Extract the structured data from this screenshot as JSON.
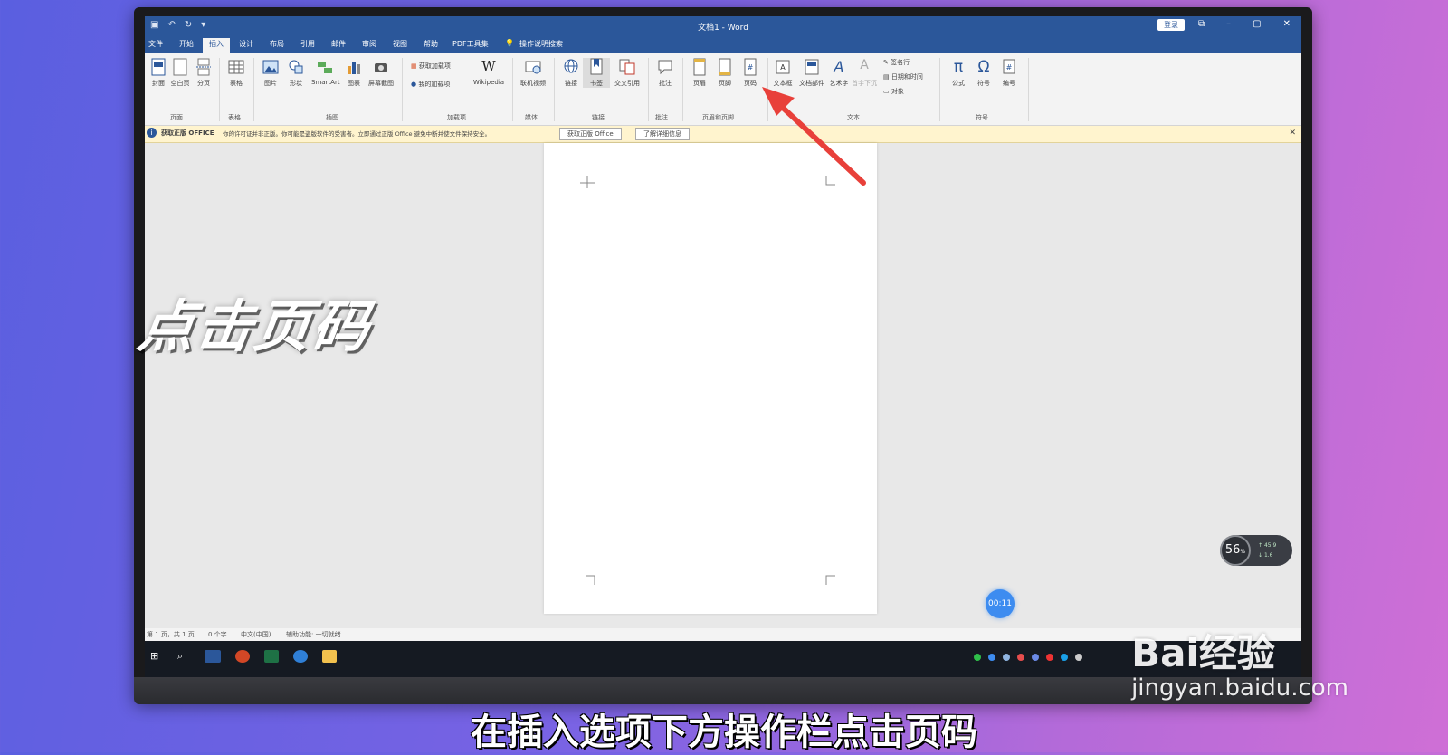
{
  "word": {
    "title": "文档1 - Word",
    "login": "登录",
    "tabs": [
      "文件",
      "开始",
      "插入",
      "设计",
      "布局",
      "引用",
      "邮件",
      "审阅",
      "视图",
      "帮助",
      "PDF工具集",
      "操作说明搜索"
    ],
    "ribbon": {
      "page_group": {
        "label": "页面",
        "items": [
          "封面",
          "空白页",
          "分页"
        ]
      },
      "table_group": {
        "label": "表格",
        "items": [
          "表格"
        ]
      },
      "illus_group": {
        "label": "插图",
        "items": [
          "图片",
          "形状",
          "SmartArt",
          "图表",
          "屏幕截图"
        ]
      },
      "addin_group": {
        "label": "加载项",
        "items": [
          "获取加载项",
          "我的加载项",
          "Wikipedia"
        ]
      },
      "media_group": {
        "label": "媒体",
        "items": [
          "联机视频"
        ]
      },
      "link_group": {
        "label": "链接",
        "items": [
          "链接",
          "书签",
          "交叉引用"
        ]
      },
      "comment_group": {
        "label": "批注",
        "items": [
          "批注"
        ]
      },
      "hf_group": {
        "label": "页眉和页脚",
        "items": [
          "页眉",
          "页脚",
          "页码"
        ]
      },
      "text_group": {
        "label": "文本",
        "items": [
          "文本框",
          "文档部件",
          "艺术字",
          "首字下沉",
          "签名行",
          "日期和时间",
          "对象"
        ]
      },
      "symbol_group": {
        "label": "符号",
        "items": [
          "公式",
          "符号",
          "编号"
        ]
      }
    },
    "infobar": {
      "title": "获取正版 OFFICE",
      "message": "你的许可证并非正版。你可能是盗版软件的受害者。立即通过正版 Office 避免中断并使文件保持安全。",
      "btn1": "获取正版 Office",
      "btn2": "了解详细信息"
    },
    "status": {
      "pages": "第 1 页，共 1 页",
      "words": "0 个字",
      "lang": "中文(中国)",
      "access": "辅助功能: 一切就绪"
    }
  },
  "overlay": {
    "title": "点击页码",
    "caption": "在插入选项下方操作栏点击页码",
    "timer": "00:11",
    "speed_pct": "56",
    "speed_unit": "%",
    "speed_up": "45.9",
    "speed_down": "1.6",
    "watermark_logo": "Bai经验",
    "watermark_url": "jingyan.baidu.com"
  },
  "colors": {
    "ribbon_blue": "#2b579a",
    "arrow": "#e8403a",
    "info_yellow": "#fff4ce"
  }
}
